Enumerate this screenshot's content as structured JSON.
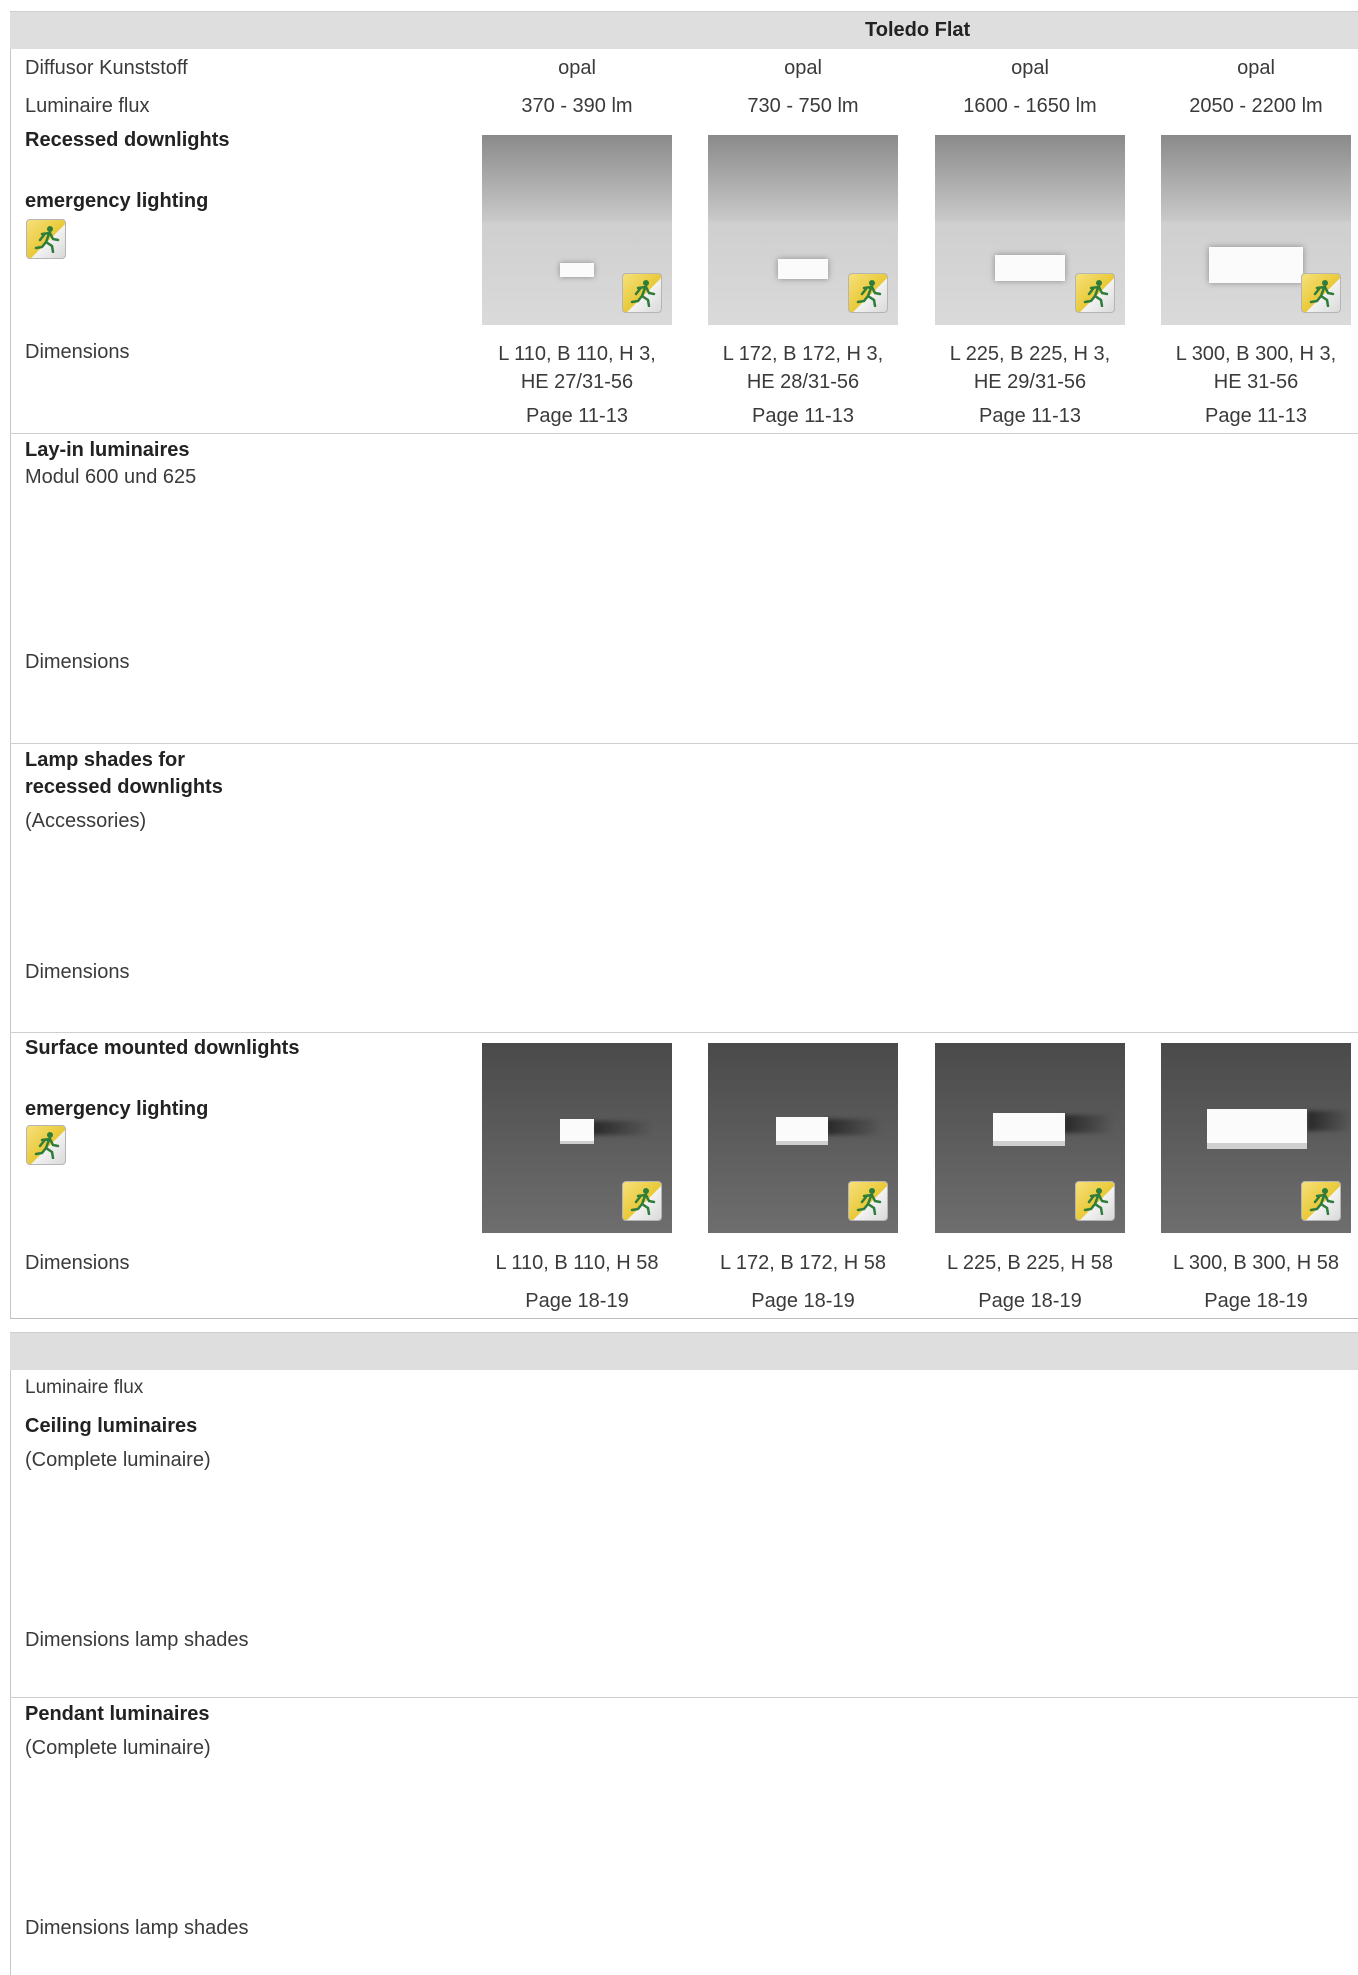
{
  "section1": {
    "header": "Toledo Flat",
    "rows": {
      "diffusor_label": "Diffusor Kunststoff",
      "diffusor_values": [
        "opal",
        "opal",
        "opal",
        "opal"
      ],
      "flux_label": "Luminaire flux",
      "flux_values": [
        "370 - 390 lm",
        "730 - 750 lm",
        "1600 - 1650 lm",
        "2050 - 2200 lm"
      ]
    },
    "recessed": {
      "title": "Recessed downlights",
      "emergency": "emergency lighting",
      "dimensions_label": "Dimensions",
      "dimensions": [
        [
          "L 110, B 110, H 3,",
          "HE 27/31-56"
        ],
        [
          "L 172, B 172, H 3,",
          "HE 28/31-56"
        ],
        [
          "L 225, B 225, H 3,",
          "HE 29/31-56"
        ],
        [
          "L 300, B 300, H 3,",
          "HE 31-56"
        ]
      ],
      "pages": [
        "Page 11-13",
        "Page 11-13",
        "Page 11-13",
        "Page 11-13"
      ]
    },
    "layin": {
      "title": "Lay-in luminaires",
      "subtitle": "Modul 600 und 625",
      "dimensions_label": "Dimensions"
    },
    "shades": {
      "title_line1": "Lamp shades for",
      "title_line2": "recessed downlights",
      "subtitle": "(Accessories)",
      "dimensions_label": "Dimensions"
    },
    "surface": {
      "title": "Surface mounted downlights",
      "emergency": "emergency lighting",
      "dimensions_label": "Dimensions",
      "dimensions": [
        "L 110, B 110, H 58",
        "L 172, B 172, H 58",
        "L 225, B 225, H 58",
        "L 300, B 300, H 58"
      ],
      "pages": [
        "Page 18-19",
        "Page 18-19",
        "Page 18-19",
        "Page 18-19"
      ]
    }
  },
  "section2": {
    "flux_label": "Luminaire flux",
    "ceiling": {
      "title": "Ceiling luminaires",
      "subtitle": "(Complete luminaire)",
      "dimensions_label": "Dimensions lamp shades"
    },
    "pendant": {
      "title": "Pendant luminaires",
      "subtitle": "(Complete luminaire)",
      "dimensions_label": "Dimensions lamp shades"
    }
  },
  "icons": {
    "emergency": "emergency-exit-icon"
  },
  "colors": {
    "header_bg": "#dedede",
    "badge_yellow": "#e9c938",
    "emergency_green": "#2f7d3a"
  }
}
